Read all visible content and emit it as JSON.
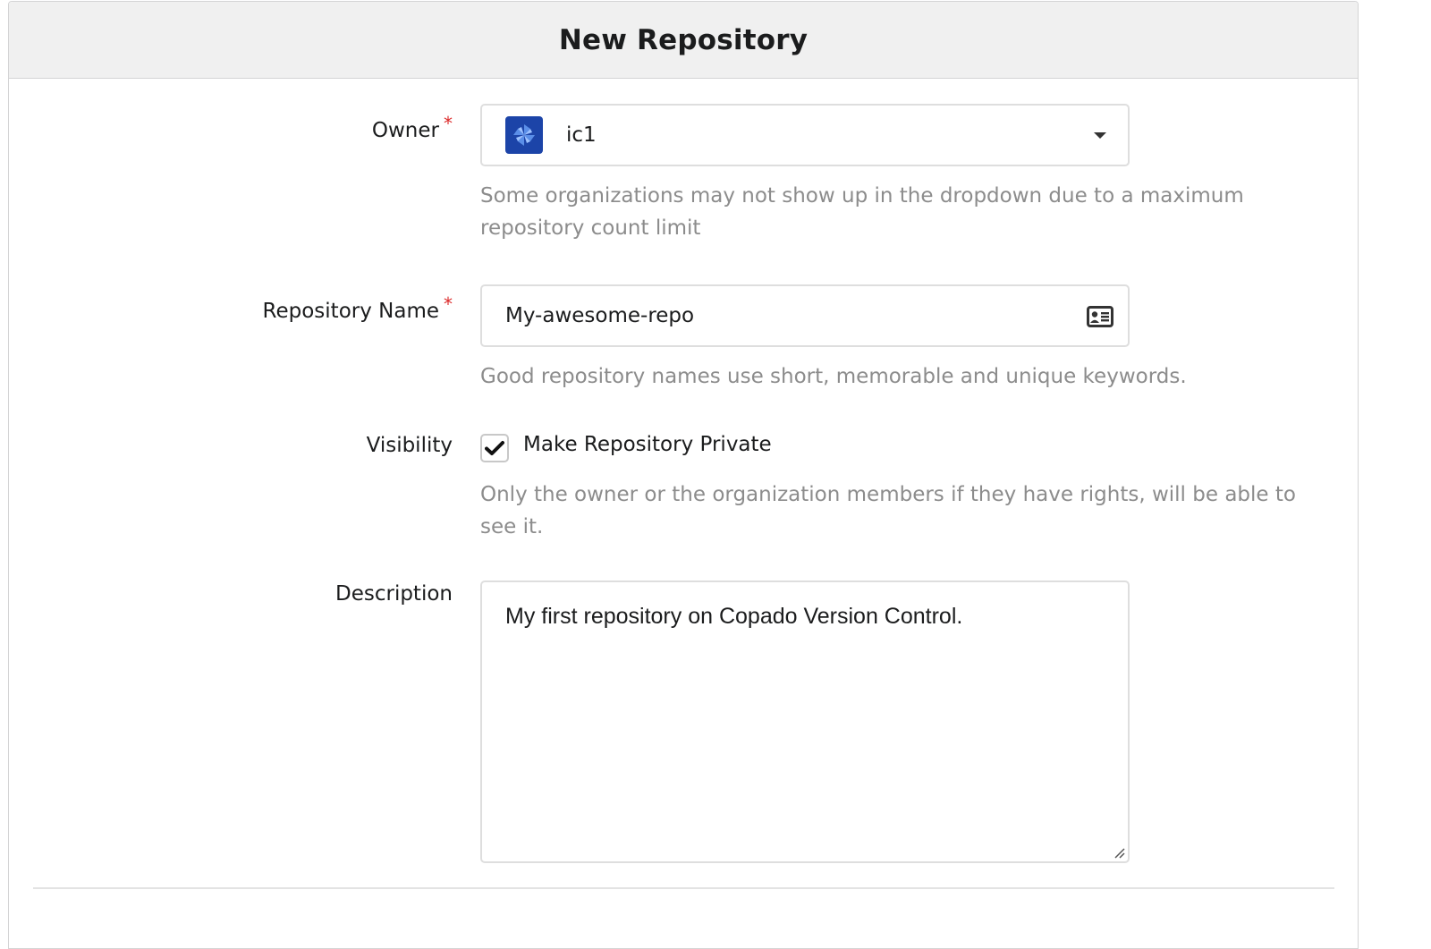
{
  "header": {
    "title": "New Repository"
  },
  "form": {
    "required_marker": "*",
    "owner": {
      "label": "Owner",
      "value": "ic1",
      "avatar_color": "#1c44a8",
      "help": "Some organizations may not show up in the dropdown due to a maximum repository count limit"
    },
    "repository_name": {
      "label": "Repository Name",
      "value": "My-awesome-repo",
      "icon": "contact-card-icon",
      "help": "Good repository names use short, memorable and unique keywords."
    },
    "visibility": {
      "label": "Visibility",
      "checkbox_label": "Make Repository Private",
      "checked": true,
      "help": "Only the owner or the organization members if they have rights, will be able to see it."
    },
    "description": {
      "label": "Description",
      "value": "My first repository on Copado Version Control."
    }
  },
  "colors": {
    "required": "#db2828",
    "help_text": "#8c8c8c",
    "header_bg": "#f0f0f0",
    "border": "#dedede"
  }
}
